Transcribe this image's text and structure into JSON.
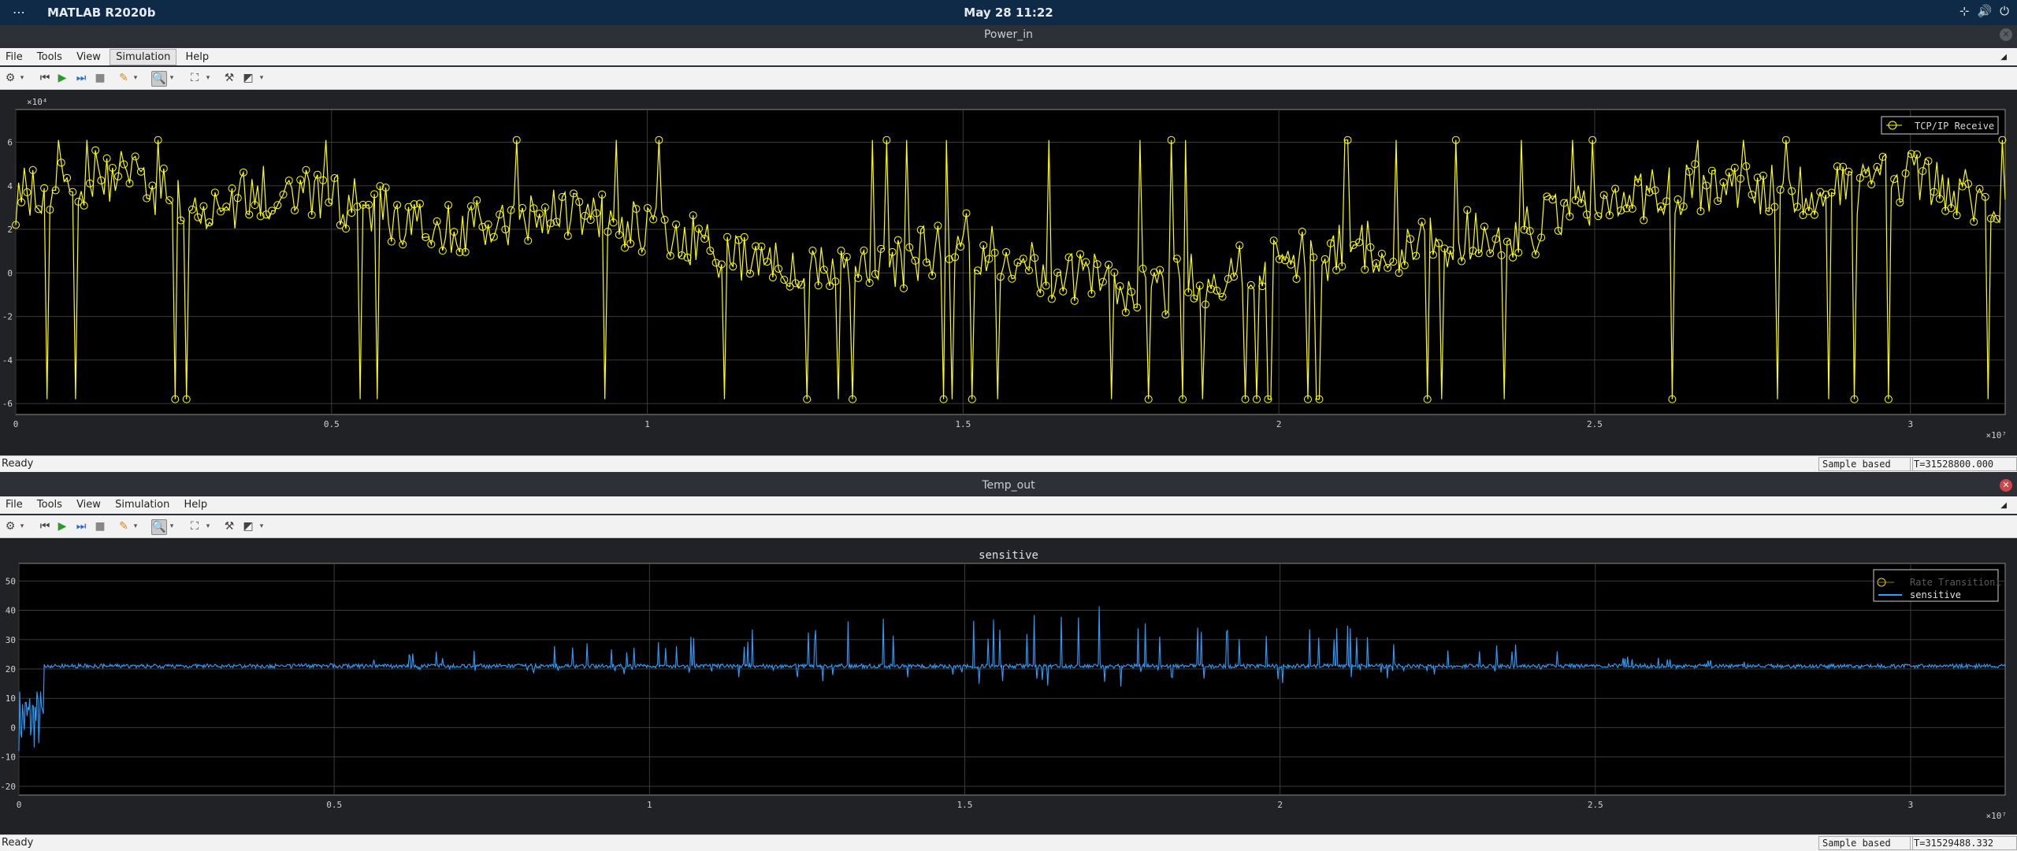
{
  "topbar": {
    "activities_icon": "dots-icon",
    "app_name": "MATLAB R2020b",
    "clock": "May 28  11:22",
    "tray_icons": [
      "network-icon",
      "volume-icon",
      "power-icon"
    ]
  },
  "windows": [
    {
      "title": "Power_in",
      "menu": [
        "File",
        "Tools",
        "View",
        "Simulation",
        "Help"
      ],
      "status": {
        "text": "Ready",
        "mode": "Sample based",
        "time": "T=31528800.000"
      },
      "chart_data": {
        "type": "line",
        "title": "",
        "series": [
          {
            "name": "TCP/IP Receive",
            "color": "#ffff00",
            "marker": "circle",
            "x": [
              0.0,
              0.15,
              0.3,
              0.45,
              0.6,
              0.75,
              0.9,
              1.05,
              1.2,
              1.35,
              1.5,
              1.65,
              1.8,
              1.95,
              2.1,
              2.25,
              2.4,
              2.55,
              2.7,
              2.85,
              3.0,
              3.15
            ],
            "y": [
              3.5,
              4.5,
              3.0,
              4.0,
              2.5,
              2.0,
              3.0,
              1.5,
              0.5,
              0.0,
              1.5,
              0.0,
              -1.0,
              0.5,
              1.0,
              1.5,
              2.0,
              3.5,
              4.0,
              3.5,
              4.5,
              3.0
            ]
          }
        ],
        "x_range": [
          0,
          3.15
        ],
        "y_range": [
          -6.5,
          7.5
        ],
        "x_ticks": [
          "0",
          "0.5",
          "1",
          "1.5",
          "2",
          "2.5",
          "3"
        ],
        "y_ticks": [
          "-6",
          "-4",
          "-2",
          "0",
          "2",
          "4",
          "6"
        ],
        "x_exponent": "×10⁷",
        "y_exponent": "×10⁴",
        "grid": true,
        "legend_position": "top-right"
      }
    },
    {
      "title": "Temp_out",
      "menu": [
        "File",
        "Tools",
        "View",
        "Simulation",
        "Help"
      ],
      "status": {
        "text": "Ready",
        "mode": "Sample based",
        "time": "T=31529488.332"
      },
      "chart_data": {
        "type": "line",
        "title": "sensitive",
        "series": [
          {
            "name": "Rate Transition1",
            "color": "#f0d000",
            "x": [],
            "y": []
          },
          {
            "name": "sensitive",
            "color": "#2a9fff",
            "x": [
              0.0,
              0.03,
              0.05,
              0.1,
              0.3,
              0.5,
              0.6,
              0.8,
              1.0,
              1.2,
              1.4,
              1.6,
              1.7,
              1.8,
              2.0,
              2.2,
              2.4,
              2.6,
              2.8,
              3.0,
              3.15
            ],
            "y": [
              5,
              -15,
              21,
              21,
              21,
              22,
              25,
              28,
              30,
              35,
              40,
              38,
              48,
              35,
              38,
              33,
              28,
              24,
              22,
              21,
              21
            ]
          }
        ],
        "x_range": [
          0,
          3.15
        ],
        "y_range": [
          -23,
          56
        ],
        "x_ticks": [
          "0",
          "0.5",
          "1",
          "1.5",
          "2",
          "2.5",
          "3"
        ],
        "y_ticks": [
          "-20",
          "-10",
          "0",
          "10",
          "20",
          "30",
          "40",
          "50"
        ],
        "x_exponent": "×10⁷",
        "grid": true,
        "legend_position": "top-right"
      }
    }
  ]
}
